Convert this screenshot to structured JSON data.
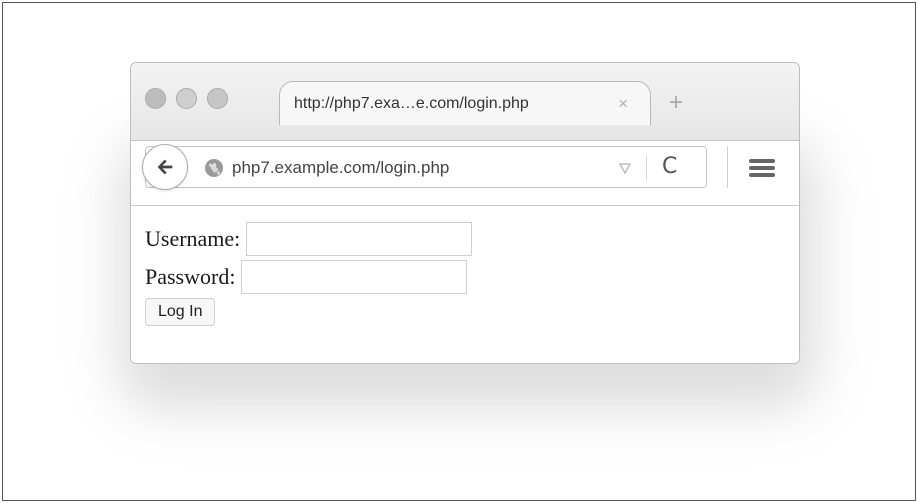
{
  "browser": {
    "tab": {
      "title": "http://php7.exa…e.com/login.php",
      "close_glyph": "×"
    },
    "new_tab_glyph": "+",
    "address": {
      "url": "php7.example.com/login.php"
    },
    "icons": {
      "back": "back-arrow-icon",
      "site": "globe-icon",
      "dropdown": "dropdown-arrow-icon",
      "reload": "reload-icon",
      "menu": "hamburger-menu-icon"
    },
    "reload_glyph": "C"
  },
  "form": {
    "username_label": "Username:",
    "username_value": "",
    "password_label": "Password:",
    "password_value": "",
    "submit_label": "Log In"
  }
}
